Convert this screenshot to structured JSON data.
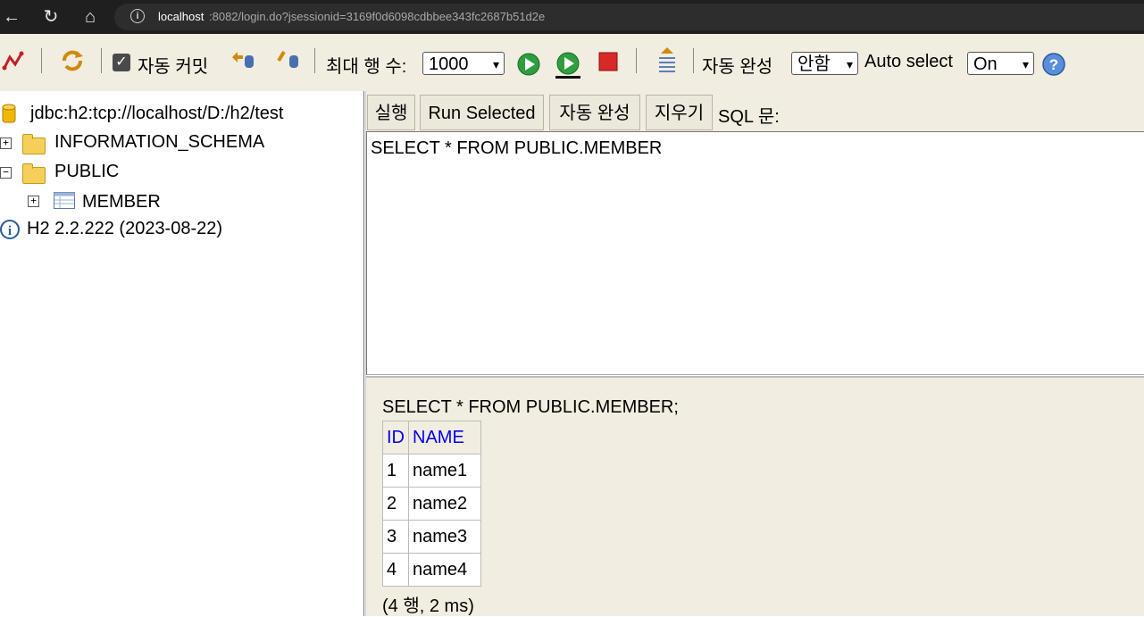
{
  "browser": {
    "url_host": "localhost",
    "url_rest": ":8082/login.do?jsessionid=3169f0d6098cdbbee343fc2687b51d2e"
  },
  "toolbar": {
    "autocommit_label": "자동 커밋",
    "autocommit_checked": true,
    "max_rows_label": "최대 행 수:",
    "max_rows_value": "1000",
    "autocomplete_label": "자동 완성",
    "autocomplete_value": "안함",
    "auto_select_label": "Auto select",
    "auto_select_value": "On"
  },
  "tree": {
    "connection": "jdbc:h2:tcp://localhost/D:/h2/test",
    "schemas": [
      {
        "name": "INFORMATION_SCHEMA",
        "expanded": false
      },
      {
        "name": "PUBLIC",
        "expanded": true
      }
    ],
    "tables": [
      {
        "name": "MEMBER"
      }
    ],
    "version": "H2 2.2.222 (2023-08-22)"
  },
  "query_buttons": {
    "run": "실행",
    "run_selected": "Run Selected",
    "autocomplete": "자동 완성",
    "clear": "지우기",
    "sql_label": "SQL 문:"
  },
  "editor": {
    "sql": "SELECT * FROM PUBLIC.MEMBER"
  },
  "result": {
    "query": "SELECT * FROM PUBLIC.MEMBER;",
    "columns": [
      "ID",
      "NAME"
    ],
    "rows": [
      [
        "1",
        "name1"
      ],
      [
        "2",
        "name2"
      ],
      [
        "3",
        "name3"
      ],
      [
        "4",
        "name4"
      ]
    ],
    "summary": "(4 행, 2 ms)"
  },
  "colors": {
    "panel_bg": "#f1ede0",
    "header_link": "#0000ee"
  }
}
